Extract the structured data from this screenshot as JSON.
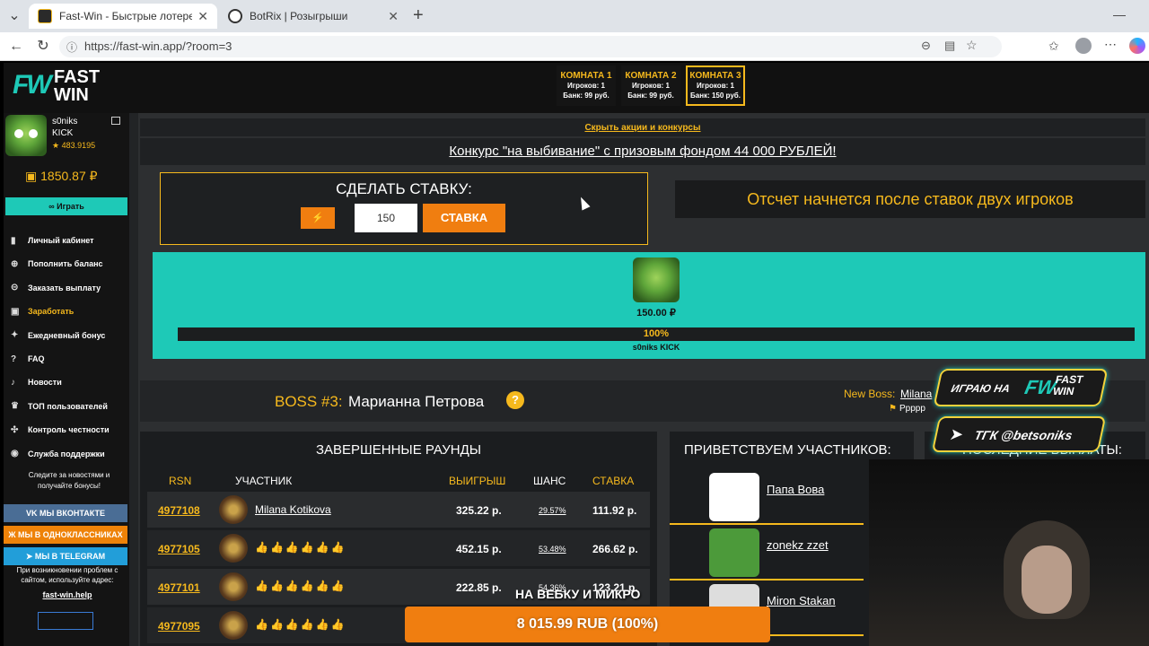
{
  "browser": {
    "tabs": [
      {
        "title": "Fast-Win - Быстрые лотереи! Ком",
        "active": true
      },
      {
        "title": "BotRix | Розыгрыши",
        "active": false
      }
    ],
    "new_tab": "+",
    "url": "https://fast-win.app/?room=3"
  },
  "site": {
    "logo": {
      "mark": "FW",
      "line1": "FAST",
      "line2": "WIN"
    },
    "rooms": [
      {
        "name": "КОМНАТА 1",
        "players": "Игроков: 1",
        "bank": "Банк: 99 руб.",
        "active": false
      },
      {
        "name": "КОМНАТА 2",
        "players": "Игроков: 1",
        "bank": "Банк: 99 руб.",
        "active": false
      },
      {
        "name": "КОМНАТА 3",
        "players": "Игроков: 1",
        "bank": "Банк: 150 руб.",
        "active": true
      }
    ],
    "user": {
      "name1": "s0niks",
      "name2": "KICK",
      "rating": "★ 483.9195",
      "balance": "1850.87 ₽"
    },
    "play_button": "∞ Играть",
    "menu": [
      {
        "icon": "user-icon",
        "glyph": "▮",
        "label": "Личный кабинет",
        "accent": false
      },
      {
        "icon": "plus-circle-icon",
        "glyph": "⊕",
        "label": "Пополнить баланс",
        "accent": false
      },
      {
        "icon": "download-circle-icon",
        "glyph": "⊝",
        "label": "Заказать выплату",
        "accent": false
      },
      {
        "icon": "money-icon",
        "glyph": "▣",
        "label": "Заработать",
        "accent": true
      },
      {
        "icon": "gift-icon",
        "glyph": "✦",
        "label": "Ежедневный бонус",
        "accent": false
      },
      {
        "icon": "question-icon",
        "glyph": "?",
        "label": "FAQ",
        "accent": false
      },
      {
        "icon": "bell-icon",
        "glyph": "♪",
        "label": "Новости",
        "accent": false
      },
      {
        "icon": "trophy-icon",
        "glyph": "♛",
        "label": "ТОП пользователей",
        "accent": false
      },
      {
        "icon": "shuffle-icon",
        "glyph": "✣",
        "label": "Контроль честности",
        "accent": false
      },
      {
        "icon": "support-icon",
        "glyph": "◉",
        "label": "Служба поддержки",
        "accent": false
      }
    ],
    "follow_text": "Следите за новостями и получайте бонусы!",
    "socials": [
      {
        "label": "VK МЫ ВКОНТАКТЕ",
        "color": "#4a6d95"
      },
      {
        "label": "Ж МЫ В ОДНОКЛАССНИКАХ",
        "color": "#ee8208"
      },
      {
        "label": "➤ МЫ В TELEGRAM",
        "color": "#229ed9"
      }
    ],
    "problem_text": "При возникновении проблем с сайтом, используйте адрес:",
    "problem_link": "fast-win.help",
    "hide_promos": "Скрыть акции и конкурсы",
    "contest": "Конкурс \"на выбивание\" с призовым фондом 44 000 РУБЛЕЙ!",
    "bet": {
      "title": "СДЕЛАТЬ СТАВКУ:",
      "value": "150",
      "button": "СТАВКА",
      "quick": "⚡"
    },
    "countdown": "Отсчет начнется после ставок двух игроков",
    "pot": {
      "amount": "150.00 ₽",
      "percent": "100%",
      "percent_value": 100,
      "player": "s0niks KICK"
    },
    "boss": {
      "label": "BOSS #3:",
      "name": "Марианна Петрова",
      "help": "?",
      "new_boss_label": "New Boss:",
      "new_boss_name": "Milana",
      "flags": "Ррррр"
    },
    "rounds": {
      "title": "ЗАВЕРШЕННЫЕ РАУНДЫ",
      "headers": {
        "rsn": "RSN",
        "player": "УЧАСТНИК",
        "win": "ВЫИГРЫШ",
        "chance": "ШАНС",
        "bet": "СТАВКА"
      },
      "rows": [
        {
          "rsn": "4977108",
          "player": "Milana Kotikova",
          "hidden": false,
          "win": "325.22 р.",
          "chance": "29.57%",
          "bet": "111.92 р."
        },
        {
          "rsn": "4977105",
          "player": "",
          "hidden": true,
          "win": "452.15 р.",
          "chance": "53.48%",
          "bet": "266.62 р."
        },
        {
          "rsn": "4977101",
          "player": "",
          "hidden": true,
          "win": "222.85 р.",
          "chance": "54.36%",
          "bet": "123.21 р."
        },
        {
          "rsn": "4977095",
          "player": "",
          "hidden": true,
          "win": "",
          "chance": "",
          "bet": ""
        }
      ],
      "hidden_glyph": "👍👍👍👍👍👍"
    },
    "welcome": {
      "title": "ПРИВЕТСТВУЕМ УЧАСТНИКОВ:",
      "users": [
        {
          "name": "Папа Вова",
          "color": "#ffffff"
        },
        {
          "name": "zonekz zzet",
          "color": "#4c9a3a"
        },
        {
          "name": "Miron Stakan",
          "color": "#dddddd"
        }
      ]
    },
    "payouts_title": "ПОСЛЕДНИЕ ВЫПЛАТЫ:"
  },
  "overlays": {
    "badge1": {
      "left": "ИГРАЮ НА",
      "right1": "FAST",
      "right2": "WIN"
    },
    "badge2": "ТГК @betsoniks",
    "caption": "НА ВЕБКУ И МИКРО",
    "bar": "8 015.99 RUB (100%)"
  },
  "colors": {
    "accent": "#f6b91d",
    "teal": "#1ec9b7",
    "orange_btn": "#f07e10"
  }
}
